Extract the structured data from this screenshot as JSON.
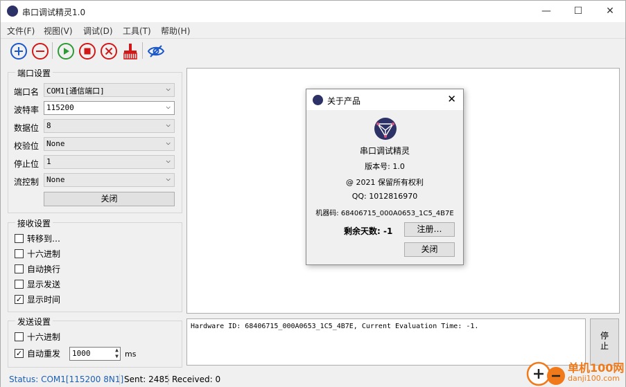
{
  "window": {
    "title": "串口调试精灵1.0",
    "minimize": "—",
    "maximize": "☐",
    "close": "✕"
  },
  "menu": [
    "文件(F)",
    "视图(V)",
    "调试(D)",
    "工具(T)",
    "帮助(H)"
  ],
  "toolbar": {
    "icons": [
      "add-icon",
      "remove-icon",
      "play-icon",
      "stop-icon",
      "delete-icon",
      "broom-icon",
      "eye-icon"
    ]
  },
  "port_settings": {
    "title": "端口设置",
    "port_label": "端口名",
    "port_value": "COM1[通信端口]",
    "baud_label": "波特率",
    "baud_value": "115200",
    "data_label": "数据位",
    "data_value": "8",
    "parity_label": "校验位",
    "parity_value": "None",
    "stop_label": "停止位",
    "stop_value": "1",
    "flow_label": "流控制",
    "flow_value": "None",
    "close_button": "关闭"
  },
  "receive_settings": {
    "title": "接收设置",
    "items": [
      {
        "label": "转移到…",
        "checked": false
      },
      {
        "label": "十六进制",
        "checked": false
      },
      {
        "label": "自动换行",
        "checked": false
      },
      {
        "label": "显示发送",
        "checked": false
      },
      {
        "label": "显示时间",
        "checked": true
      }
    ]
  },
  "send_settings": {
    "title": "发送设置",
    "hex_label": "十六进制",
    "hex_checked": false,
    "auto_label": "自动重发",
    "auto_checked": true,
    "interval_value": "1000",
    "unit": "ms"
  },
  "send_area": {
    "text": "Hardware ID: 68406715_000A0653_1C5_4B7E, Current Evaluation Time: -1."
  },
  "stop_button": "停\n止",
  "status": {
    "port": "Status: COM1[115200 8N1]",
    "sent": "Sent: 2485",
    "received": "Received: 0"
  },
  "about_dialog": {
    "title": "关于产品",
    "product": "串口调试精灵",
    "version": "版本号: 1.0",
    "copyright": "@ 2021 保留所有权利",
    "qq": "QQ: 1012816970",
    "machine": "机器码: 68406715_000A0653_1C5_4B7E",
    "days_label": "剩余天数: -1",
    "register_button": "注册…",
    "close_button": "关闭"
  },
  "watermark": {
    "text": "单机100网",
    "url": "danji100.com"
  },
  "colors": {
    "accent_blue": "#1a57c8",
    "play_green": "#2e9a35",
    "stop_red": "#d01818",
    "status_blue": "#1a5fb4"
  }
}
